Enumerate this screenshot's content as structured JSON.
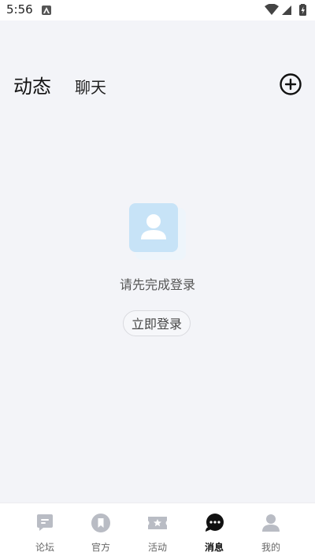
{
  "status_bar": {
    "time": "5:56"
  },
  "header": {
    "tabs": [
      {
        "label": "动态",
        "active": true
      },
      {
        "label": "聊天",
        "active": false
      }
    ],
    "add_icon": "plus-circle-icon"
  },
  "empty_state": {
    "message": "请先完成登录",
    "login_button": "立即登录",
    "illustration_icon": "user-card-icon"
  },
  "bottom_nav": {
    "items": [
      {
        "label": "论坛",
        "icon": "forum-icon",
        "active": false
      },
      {
        "label": "官方",
        "icon": "official-icon",
        "active": false
      },
      {
        "label": "活动",
        "icon": "ticket-icon",
        "active": false
      },
      {
        "label": "消息",
        "icon": "message-icon",
        "active": true
      },
      {
        "label": "我的",
        "icon": "profile-icon",
        "active": false
      }
    ]
  },
  "colors": {
    "background": "#f3f4f8",
    "illustration": "#c7e3f7",
    "nav_inactive": "#b9bcc4",
    "nav_active": "#111111"
  }
}
